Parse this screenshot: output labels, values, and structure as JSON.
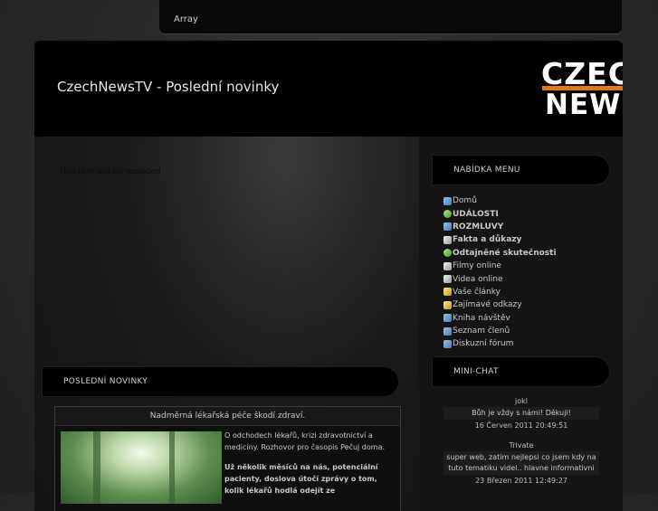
{
  "topbar": {
    "text": "Array"
  },
  "header": {
    "title": "CzechNewsTV - Poslední novinky",
    "logo_line1": "CZECH",
    "logo_line2": "NEWS"
  },
  "content": {
    "placeholder": "This text will be replaced"
  },
  "sidebar": {
    "menu_title": "NABÍDKA MENU",
    "menu": [
      {
        "label": "Domů",
        "icon": "home-icon",
        "bold": false
      },
      {
        "label": "UDÁLOSTI",
        "icon": "events-icon",
        "bold": true
      },
      {
        "label": "ROZMLUVY",
        "icon": "chat-icon",
        "bold": true
      },
      {
        "label": "Fakta a důkazy",
        "icon": "facts-icon",
        "bold": true
      },
      {
        "label": "Odtajněné skutečnosti",
        "icon": "globe-icon",
        "bold": true
      },
      {
        "label": "Filmy online",
        "icon": "film-icon",
        "bold": false
      },
      {
        "label": "Videa online",
        "icon": "video-icon",
        "bold": false
      },
      {
        "label": "Vaše články",
        "icon": "articles-icon",
        "bold": false
      },
      {
        "label": "Zajímavé odkazy",
        "icon": "links-icon",
        "bold": false
      },
      {
        "label": "Kniha návštěv",
        "icon": "guestbook-icon",
        "bold": false
      },
      {
        "label": "Seznam členů",
        "icon": "members-icon",
        "bold": false
      },
      {
        "label": "Diskuzní fórum",
        "icon": "forum-icon",
        "bold": false
      }
    ],
    "chat_title": "MINI-CHAT",
    "chat": [
      {
        "nick": "jokl",
        "message": "Bůh je vždy s námi! Děkuji!",
        "time": "16 Červen 2011 20:49:51"
      },
      {
        "nick": "Trivate",
        "message": "super web, zatim nejlepsi co jsem kdy na tuto tematiku videl.. hlavne informativni",
        "time": "23 Březen 2011 12:49:27"
      }
    ]
  },
  "news": {
    "section_title": "POSLEDNÍ NOVINKY",
    "article_title": "Nadměrná lékařská péče škodí zdraví.",
    "intro": "O odchodech lékařů, krizi zdravotnictví a medicíny. Rozhovor pro časopis Pečuj doma.",
    "lead": "Už několik měsíců na nás, potenciální pacienty, doslova útočí zprávy o tom, kolik lékařů hodlá odejít ze "
  }
}
